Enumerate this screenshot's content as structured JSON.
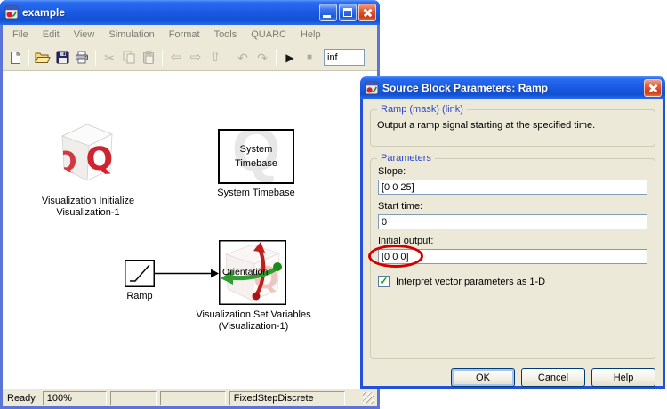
{
  "colors": {
    "titlebar_blue": "#1b5ce4",
    "window_border": "#5b74d8",
    "dialog_border": "#2050dc",
    "face": "#ece9d8",
    "group_caption_blue": "#2b48c8",
    "annotation_red": "#d40000",
    "check_green": "#16a015",
    "block_red": "#cf2330",
    "arrow_green": "#2f9e2f",
    "arrow_red": "#c21d1d"
  },
  "icons": {
    "cut": "✂",
    "back": "⇦",
    "forward": "⇨",
    "up": "⇧",
    "undo": "↶",
    "redo": "↷",
    "play": "▶",
    "stop": "■",
    "check": "✓"
  },
  "main_window": {
    "title": "example",
    "menu_items": [
      "File",
      "Edit",
      "View",
      "Simulation",
      "Format",
      "Tools",
      "QUARC",
      "Help"
    ],
    "toolbar": {
      "icon_names": [
        "new",
        "open",
        "save",
        "print",
        "cut",
        "copy",
        "paste",
        "back",
        "forward",
        "up",
        "undo",
        "redo",
        "play",
        "stop"
      ],
      "sim_stop_time": "inf"
    },
    "status_bar": {
      "ready": "Ready",
      "zoom": "100%",
      "panel3": "",
      "panel4": "",
      "solver": "FixedStepDiscrete"
    }
  },
  "canvas": {
    "cube_letter": "Q",
    "blocks": {
      "viz_init": {
        "label": "Visualization Initialize\nVisualization-1"
      },
      "system_timebase": {
        "inner_text": "System\nTimebase",
        "label": "System Timebase",
        "watermark": "Q"
      },
      "ramp": {
        "label": "Ramp"
      },
      "viz_set": {
        "port_label": "Orientation",
        "label": "Visualization Set Variables\n(Visualization-1)"
      }
    }
  },
  "dialog": {
    "title": "Source Block Parameters: Ramp",
    "mask_group": {
      "caption": "Ramp (mask) (link)",
      "description": "Output a ramp signal starting at the specified time."
    },
    "params_group": {
      "caption": "Parameters",
      "slope": {
        "label": "Slope:",
        "value": "[0 0 25]"
      },
      "start_time": {
        "label": "Start time:",
        "value": "0"
      },
      "initial_output": {
        "label": "Initial output:",
        "value": "[0 0 0]",
        "annotated": true
      },
      "checkbox": {
        "label": "Interpret vector parameters as 1-D",
        "checked": true
      }
    },
    "buttons": {
      "ok": "OK",
      "cancel": "Cancel",
      "help": "Help"
    }
  }
}
